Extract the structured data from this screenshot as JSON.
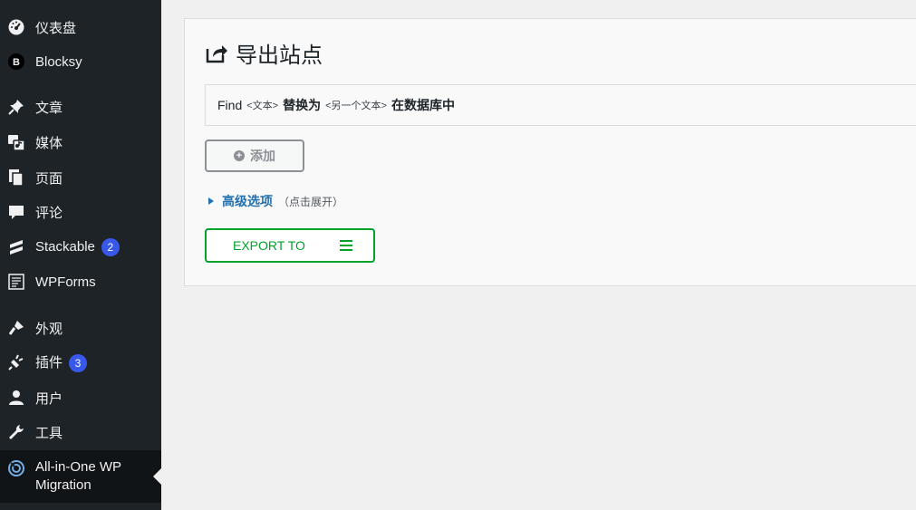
{
  "sidebar": {
    "items": [
      {
        "label": "仪表盘",
        "icon": "dashboard-icon"
      },
      {
        "label": "Blocksy",
        "icon": "blocksy-icon"
      },
      {
        "label": "文章",
        "icon": "pin-icon"
      },
      {
        "label": "媒体",
        "icon": "media-icon"
      },
      {
        "label": "页面",
        "icon": "page-icon"
      },
      {
        "label": "评论",
        "icon": "comment-icon"
      },
      {
        "label": "Stackable",
        "icon": "stackable-icon",
        "badge": "2"
      },
      {
        "label": "WPForms",
        "icon": "wpforms-icon"
      },
      {
        "label": "外观",
        "icon": "brush-icon"
      },
      {
        "label": "插件",
        "icon": "plugin-icon",
        "badge": "3"
      },
      {
        "label": "用户",
        "icon": "user-icon"
      },
      {
        "label": "工具",
        "icon": "wrench-icon"
      },
      {
        "label": "All-in-One WP Migration",
        "icon": "migration-icon"
      }
    ],
    "badge_color": "#3858e9",
    "background": "#1d2327"
  },
  "main": {
    "title": "导出站点",
    "find": {
      "find_word": "Find",
      "text_placeholder": "<文本>",
      "replace_word": "替换为",
      "other_text_placeholder": "<另一个文本>",
      "in_db": "在数据库中"
    },
    "add_button": "添加",
    "advanced": {
      "link": "高级选项",
      "hint": "（点击展开）"
    },
    "export_button": "EXPORT TO",
    "accent_color": "#00a32a",
    "link_color": "#2271b1"
  }
}
